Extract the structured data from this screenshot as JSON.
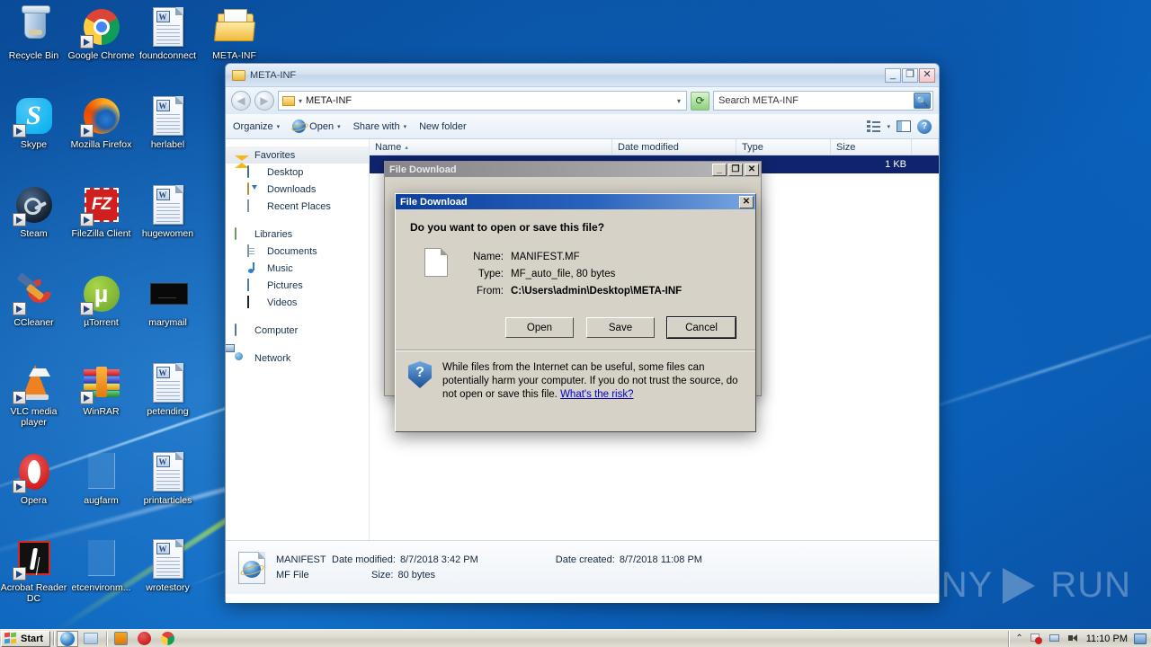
{
  "desktop": {
    "icons": [
      {
        "label": "Recycle Bin",
        "kind": "recycle-bin",
        "shortcut": false
      },
      {
        "label": "Google Chrome",
        "kind": "chrome",
        "shortcut": true
      },
      {
        "label": "foundconnect",
        "kind": "word-doc",
        "shortcut": false
      },
      {
        "label": "META-INF",
        "kind": "folder-open",
        "shortcut": false
      },
      {
        "label": "Skype",
        "kind": "skype",
        "shortcut": true
      },
      {
        "label": "Mozilla Firefox",
        "kind": "firefox",
        "shortcut": true
      },
      {
        "label": "herlabel",
        "kind": "word-doc",
        "shortcut": false
      },
      {
        "label": "Steam",
        "kind": "steam",
        "shortcut": true
      },
      {
        "label": "FileZilla Client",
        "kind": "filezilla",
        "shortcut": true
      },
      {
        "label": "hugewomen",
        "kind": "word-doc",
        "shortcut": false
      },
      {
        "label": "CCleaner",
        "kind": "ccleaner",
        "shortcut": true
      },
      {
        "label": "µTorrent",
        "kind": "utorrent",
        "shortcut": true
      },
      {
        "label": "marymail",
        "kind": "black-image",
        "shortcut": false
      },
      {
        "label": "VLC media player",
        "kind": "vlc",
        "shortcut": true
      },
      {
        "label": "WinRAR",
        "kind": "winrar",
        "shortcut": true
      },
      {
        "label": "petending",
        "kind": "word-doc",
        "shortcut": false
      },
      {
        "label": "Opera",
        "kind": "opera",
        "shortcut": true
      },
      {
        "label": "augfarm",
        "kind": "plain-doc",
        "shortcut": false
      },
      {
        "label": "printarticles",
        "kind": "word-doc",
        "shortcut": false
      },
      {
        "label": "Acrobat Reader DC",
        "kind": "acrobat",
        "shortcut": true
      },
      {
        "label": "etcenvironm...",
        "kind": "plain-doc",
        "shortcut": false
      },
      {
        "label": "wrotestory",
        "kind": "word-doc",
        "shortcut": false
      }
    ]
  },
  "explorer": {
    "title": "META-INF",
    "window_buttons": {
      "minimize": "_",
      "maximize": "❐",
      "close": "✕"
    },
    "address": {
      "folder_label": "META-INF",
      "dropdown": "▾",
      "separator": "▾"
    },
    "refresh_label": "⟳",
    "search": {
      "placeholder": "Search META-INF",
      "value": "Search META-INF",
      "button_icon": "search-icon"
    },
    "toolbar": {
      "organize": "Organize",
      "open": "Open",
      "share_with": "Share with",
      "new_folder": "New folder",
      "arrow": "▾"
    },
    "navpane": {
      "groups": [
        {
          "header": "Favorites",
          "icon": "star-icon",
          "selected": true,
          "items": [
            {
              "label": "Desktop",
              "icon": "desktop-icon"
            },
            {
              "label": "Downloads",
              "icon": "downloads-icon"
            },
            {
              "label": "Recent Places",
              "icon": "recent-places-icon"
            }
          ]
        },
        {
          "header": "Libraries",
          "icon": "libraries-icon",
          "selected": false,
          "items": [
            {
              "label": "Documents",
              "icon": "documents-icon"
            },
            {
              "label": "Music",
              "icon": "music-icon"
            },
            {
              "label": "Pictures",
              "icon": "pictures-icon"
            },
            {
              "label": "Videos",
              "icon": "videos-icon"
            }
          ]
        },
        {
          "header": "Computer",
          "icon": "computer-icon",
          "selected": false,
          "items": []
        },
        {
          "header": "Network",
          "icon": "network-icon",
          "selected": false,
          "items": []
        }
      ]
    },
    "columns": {
      "name": "Name",
      "date_modified": "Date modified",
      "type": "Type",
      "size": "Size",
      "sort_arrow": "▴"
    },
    "rows": [
      {
        "name": "",
        "date_modified": "",
        "type": "",
        "size": "1 KB",
        "selected": true
      }
    ],
    "details": {
      "file_name": "MANIFEST",
      "file_type": "MF File",
      "date_modified_label": "Date modified:",
      "date_modified": "8/7/2018 3:42 PM",
      "date_created_label": "Date created:",
      "date_created": "8/7/2018 11:08 PM",
      "size_label": "Size:",
      "size": "80 bytes"
    }
  },
  "file_download_outer": {
    "title": "File Download",
    "buttons": {
      "minimize": "_",
      "maximize": "❐",
      "close": "✕"
    }
  },
  "file_download": {
    "title": "File Download",
    "close_button": "✕",
    "question": "Do you want to open or save this file?",
    "fields": [
      {
        "label": "Name:",
        "value": "MANIFEST.MF",
        "bold": false
      },
      {
        "label": "Type:",
        "value": "MF_auto_file, 80 bytes",
        "bold": false
      },
      {
        "label": "From:",
        "value": "C:\\Users\\admin\\Desktop\\META-INF",
        "bold": true
      }
    ],
    "buttons": {
      "open": "Open",
      "save": "Save",
      "cancel": "Cancel",
      "default": "cancel"
    },
    "warning": {
      "text": "While files from the Internet can be useful, some files can potentially harm your computer. If you do not trust the source, do not open or save this file.",
      "link": "What's the risk?",
      "icon": "question-shield-icon"
    }
  },
  "taskbar": {
    "start_label": "Start",
    "quicklaunch": [
      {
        "name": "internet-explorer",
        "active": true
      },
      {
        "name": "windows-explorer",
        "active": false
      }
    ],
    "tasks": [
      {
        "name": "media-player-button"
      },
      {
        "name": "opera-button"
      },
      {
        "name": "chrome-button"
      }
    ],
    "tray": [
      {
        "name": "show-hidden-icons",
        "glyph": "⌃"
      },
      {
        "name": "action-center-flag-icon"
      },
      {
        "name": "network-icon"
      },
      {
        "name": "volume-icon"
      }
    ],
    "clock": "11:10 PM",
    "show_desktop": "show-desktop-button"
  },
  "watermark": {
    "left": "ANY",
    "right": "RUN"
  }
}
